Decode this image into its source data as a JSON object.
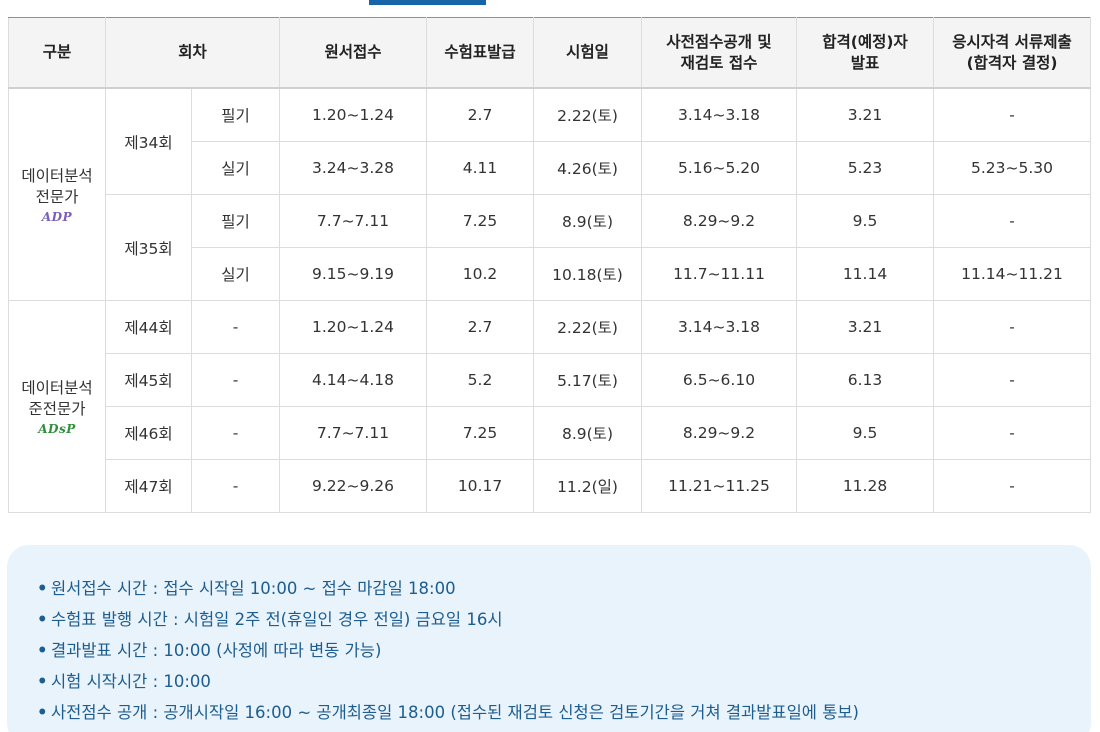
{
  "headers": {
    "category": "구분",
    "round": "회차",
    "application": "원서접수",
    "ticket": "수험표발급",
    "exam_date": "시험일",
    "prescore_line1": "사전점수공개 및",
    "prescore_line2": "재검토 접수",
    "result_line1": "합격(예정)자",
    "result_line2": "발표",
    "docs_line1": "응시자격 서류제출",
    "docs_line2": "(합격자 결정)"
  },
  "groups": {
    "adp": {
      "name_line1": "데이터분석",
      "name_line2": "전문가",
      "badge": "ADP",
      "badge_color": "#7a5fb8"
    },
    "adsp": {
      "name_line1": "데이터분석",
      "name_line2": "준전문가",
      "badge": "ADsP",
      "badge_color": "#2f8f3a"
    }
  },
  "adp_rounds": [
    {
      "round": "제34회",
      "rows": [
        {
          "type": "필기",
          "application": "1.20~1.24",
          "ticket": "2.7",
          "exam_date": "2.22(토)",
          "prescore": "3.14~3.18",
          "result": "3.21",
          "docs": "-"
        },
        {
          "type": "실기",
          "application": "3.24~3.28",
          "ticket": "4.11",
          "exam_date": "4.26(토)",
          "prescore": "5.16~5.20",
          "result": "5.23",
          "docs": "5.23~5.30"
        }
      ]
    },
    {
      "round": "제35회",
      "rows": [
        {
          "type": "필기",
          "application": "7.7~7.11",
          "ticket": "7.25",
          "exam_date": "8.9(토)",
          "prescore": "8.29~9.2",
          "result": "9.5",
          "docs": "-"
        },
        {
          "type": "실기",
          "application": "9.15~9.19",
          "ticket": "10.2",
          "exam_date": "10.18(토)",
          "prescore": "11.7~11.11",
          "result": "11.14",
          "docs": "11.14~11.21"
        }
      ]
    }
  ],
  "adsp_rows": [
    {
      "round": "제44회",
      "type": "-",
      "application": "1.20~1.24",
      "ticket": "2.7",
      "exam_date": "2.22(토)",
      "prescore": "3.14~3.18",
      "result": "3.21",
      "docs": "-"
    },
    {
      "round": "제45회",
      "type": "-",
      "application": "4.14~4.18",
      "ticket": "5.2",
      "exam_date": "5.17(토)",
      "prescore": "6.5~6.10",
      "result": "6.13",
      "docs": "-"
    },
    {
      "round": "제46회",
      "type": "-",
      "application": "7.7~7.11",
      "ticket": "7.25",
      "exam_date": "8.9(토)",
      "prescore": "8.29~9.2",
      "result": "9.5",
      "docs": "-"
    },
    {
      "round": "제47회",
      "type": "-",
      "application": "9.22~9.26",
      "ticket": "10.17",
      "exam_date": "11.2(일)",
      "prescore": "11.21~11.25",
      "result": "11.28",
      "docs": "-"
    }
  ],
  "notes": [
    "원서접수 시간 : 접수 시작일 10:00 ~ 접수 마감일 18:00",
    "수험표 발행 시간 : 시험일 2주 전(휴일인 경우 전일) 금요일 16시",
    "결과발표 시간 : 10:00 (사정에 따라 변동 가능)",
    "시험 시작시간 : 10:00",
    "사전점수 공개 : 공개시작일 16:00 ~ 공개최종일 18:00 (접수된 재검토 신청은 검토기간을 거쳐 결과발표일에 통보)"
  ],
  "bullet": "•",
  "colors": {
    "accent": "#1565a8",
    "notes_bg": "#e9f3fb",
    "notes_text": "#1e5d8f",
    "header_bg": "#f4f4f4"
  }
}
